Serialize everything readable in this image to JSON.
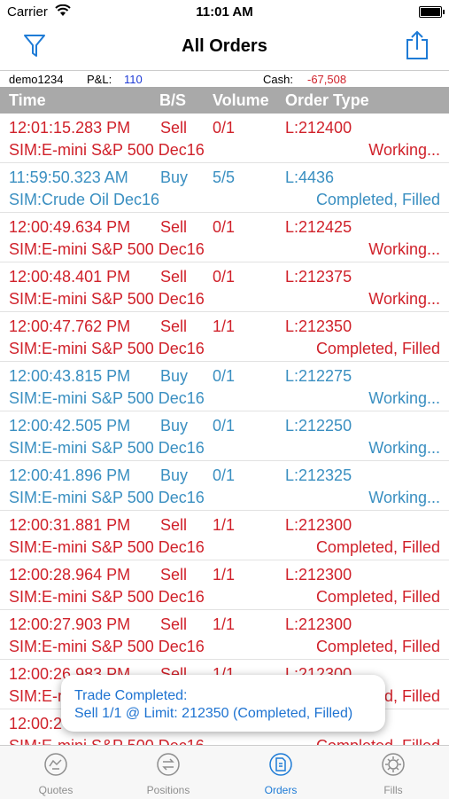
{
  "status_bar": {
    "carrier": "Carrier",
    "time": "11:01 AM",
    "battery_level": 1.0
  },
  "nav": {
    "title": "All Orders"
  },
  "account": {
    "id": "demo1234",
    "pnl_label": "P&L:",
    "pnl_value": "110",
    "cash_label": "Cash:",
    "cash_value": "-67,508"
  },
  "table": {
    "columns": {
      "time": "Time",
      "bs": "B/S",
      "volume": "Volume",
      "order_type": "Order Type"
    },
    "rows": [
      {
        "time": "12:01:15.283 PM",
        "side": "Sell",
        "volume": "0/1",
        "order": "L:212400",
        "instrument": "SIM:E-mini S&P 500 Dec16",
        "status": "Working..."
      },
      {
        "time": "11:59:50.323 AM",
        "side": "Buy",
        "volume": "5/5",
        "order": "L:4436",
        "instrument": "SIM:Crude Oil Dec16",
        "status": "Completed, Filled"
      },
      {
        "time": "12:00:49.634 PM",
        "side": "Sell",
        "volume": "0/1",
        "order": "L:212425",
        "instrument": "SIM:E-mini S&P 500 Dec16",
        "status": "Working..."
      },
      {
        "time": "12:00:48.401 PM",
        "side": "Sell",
        "volume": "0/1",
        "order": "L:212375",
        "instrument": "SIM:E-mini S&P 500 Dec16",
        "status": "Working..."
      },
      {
        "time": "12:00:47.762 PM",
        "side": "Sell",
        "volume": "1/1",
        "order": "L:212350",
        "instrument": "SIM:E-mini S&P 500 Dec16",
        "status": "Completed, Filled"
      },
      {
        "time": "12:00:43.815 PM",
        "side": "Buy",
        "volume": "0/1",
        "order": "L:212275",
        "instrument": "SIM:E-mini S&P 500 Dec16",
        "status": "Working..."
      },
      {
        "time": "12:00:42.505 PM",
        "side": "Buy",
        "volume": "0/1",
        "order": "L:212250",
        "instrument": "SIM:E-mini S&P 500 Dec16",
        "status": "Working..."
      },
      {
        "time": "12:00:41.896 PM",
        "side": "Buy",
        "volume": "0/1",
        "order": "L:212325",
        "instrument": "SIM:E-mini S&P 500 Dec16",
        "status": "Working..."
      },
      {
        "time": "12:00:31.881 PM",
        "side": "Sell",
        "volume": "1/1",
        "order": "L:212300",
        "instrument": "SIM:E-mini S&P 500 Dec16",
        "status": "Completed, Filled"
      },
      {
        "time": "12:00:28.964 PM",
        "side": "Sell",
        "volume": "1/1",
        "order": "L:212300",
        "instrument": "SIM:E-mini S&P 500 Dec16",
        "status": "Completed, Filled"
      },
      {
        "time": "12:00:27.903 PM",
        "side": "Sell",
        "volume": "1/1",
        "order": "L:212300",
        "instrument": "SIM:E-mini S&P 500 Dec16",
        "status": "Completed, Filled"
      },
      {
        "time": "12:00:26.983 PM",
        "side": "Sell",
        "volume": "1/1",
        "order": "L:212300",
        "instrument": "SIM:E-mini S&P 500 Dec16",
        "status": "Completed, Filled"
      },
      {
        "time": "12:00:2",
        "side": "",
        "volume": "",
        "order": "",
        "instrument": "SIM:E-mini S&P 500 Dec16",
        "status": "Completed, Filled"
      }
    ]
  },
  "toast": {
    "line1": "Trade Completed:",
    "line2": "Sell 1/1 @ Limit: 212350 (Completed, Filled)"
  },
  "tabs": [
    {
      "label": "Quotes",
      "icon": "quotes-icon"
    },
    {
      "label": "Positions",
      "icon": "positions-icon"
    },
    {
      "label": "Orders",
      "icon": "orders-icon",
      "active": true
    },
    {
      "label": "Fills",
      "icon": "fills-icon"
    }
  ],
  "colors": {
    "sell": "#d0212a",
    "buy": "#3a8fc1",
    "accent": "#1e7bd6",
    "header_bg": "#a9a9a9"
  }
}
